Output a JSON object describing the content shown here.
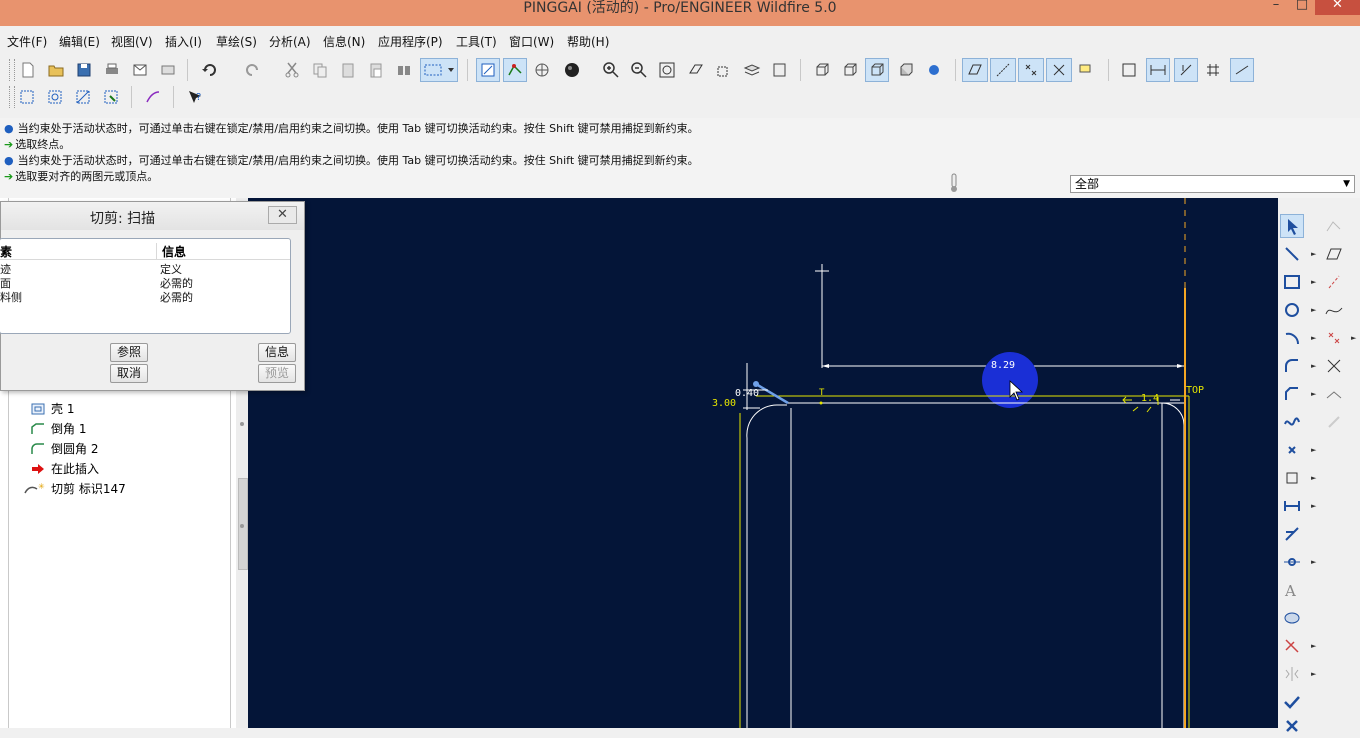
{
  "window": {
    "title": "PINGGAI (活动的) - Pro/ENGINEER Wildfire 5.0",
    "minimize": "–",
    "restore": "□",
    "close": "✕"
  },
  "menu": [
    "文件(F)",
    "编辑(E)",
    "视图(V)",
    "插入(I)",
    "草绘(S)",
    "分析(A)",
    "信息(N)",
    "应用程序(P)",
    "工具(T)",
    "窗口(W)",
    "帮助(H)"
  ],
  "messages": [
    {
      "type": "info",
      "text": "当约束处于活动状态时，可通过单击右键在锁定/禁用/启用约束之间切换。使用 Tab 键可切换活动约束。按住 Shift 键可禁用捕捉到新约束。"
    },
    {
      "type": "prompt",
      "text": "选取终点。"
    },
    {
      "type": "info",
      "text": "当约束处于活动状态时，可通过单击右键在锁定/禁用/启用约束之间切换。使用 Tab 键可切换活动约束。按住 Shift 键可禁用捕捉到新约束。"
    },
    {
      "type": "prompt",
      "text": "选取要对齐的两图元或顶点。"
    }
  ],
  "filter": {
    "value": "全部"
  },
  "tree": {
    "items": [
      {
        "label": "壳 1",
        "icon": "shell-icon"
      },
      {
        "label": "倒角 1",
        "icon": "chamfer-icon"
      },
      {
        "label": "倒圆角 2",
        "icon": "round-icon"
      },
      {
        "label": "在此插入",
        "icon": "insert-here-arrow-icon"
      },
      {
        "label": "切剪 标识147",
        "icon": "cut-feature-icon"
      }
    ]
  },
  "dialog": {
    "title": "切剪: 扫描",
    "close": "✕",
    "col_element": "素",
    "col_info": "信息",
    "rows": [
      {
        "element": "迹",
        "info": "定义"
      },
      {
        "element": "面",
        "info": "必需的"
      },
      {
        "element": "料侧",
        "info": "必需的"
      }
    ],
    "buttons": {
      "refs": "参照",
      "info": "信息",
      "cancel": "取消",
      "preview": "预览"
    }
  },
  "sketch": {
    "dims": {
      "width": "8.29",
      "small": "0.40",
      "left": "3.00",
      "right": "1.4"
    },
    "labels": {
      "top": "TOP",
      "t_marker": "T"
    },
    "colors": {
      "background": "#041538",
      "yellow": "#e6e600",
      "white": "#ffffff",
      "orange": "#f5a623",
      "highlight": "#1a2fd6"
    }
  }
}
